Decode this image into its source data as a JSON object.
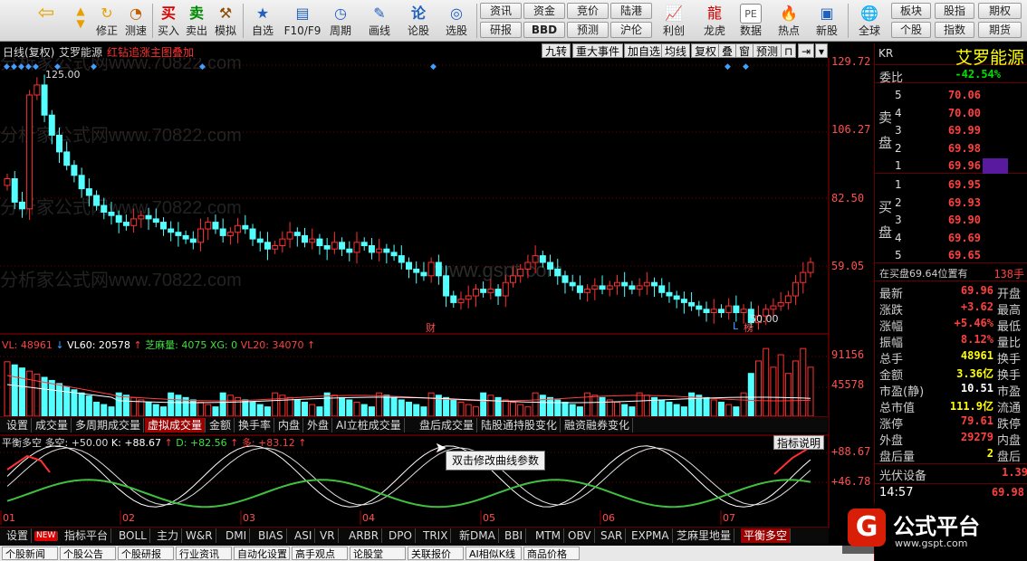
{
  "toolbar": {
    "buttons": [
      {
        "label": "",
        "icon": "back-arrow-icon"
      },
      {
        "label": "修正",
        "icon": "refresh-icon"
      },
      {
        "label": "测速",
        "icon": "clock-icon"
      },
      {
        "label": "买入",
        "icon": "buy-icon",
        "glyph": "买"
      },
      {
        "label": "卖出",
        "icon": "sell-icon",
        "glyph": "卖"
      },
      {
        "label": "模拟",
        "icon": "hammer-icon"
      },
      {
        "label": "自选",
        "icon": "star-icon"
      },
      {
        "label": "F10/F9",
        "icon": "f10-icon"
      },
      {
        "label": "周期",
        "icon": "cycle-icon"
      },
      {
        "label": "画线",
        "icon": "pencil-icon"
      },
      {
        "label": "论股",
        "icon": "discuss-icon",
        "glyph": "论"
      },
      {
        "label": "选股",
        "icon": "select-stock-icon"
      },
      {
        "label": "利创",
        "icon": "chart-icon"
      },
      {
        "label": "龙虎",
        "icon": "dragon-icon"
      },
      {
        "label": "数据",
        "icon": "pe-icon",
        "glyph": "PE"
      },
      {
        "label": "热点",
        "icon": "hot-icon"
      },
      {
        "label": "新股",
        "icon": "ipo-icon"
      },
      {
        "label": "全球",
        "icon": "globe-icon"
      }
    ],
    "pills_top": [
      "资讯",
      "资金",
      "竞价",
      "陆港"
    ],
    "pills_bottom": [
      "研报",
      "BBD",
      "预测",
      "沪伦"
    ],
    "right_pills_top": [
      "板块",
      "股指",
      "期权"
    ],
    "right_pills_bottom": [
      "个股",
      "指数",
      "期货"
    ]
  },
  "chart": {
    "title_prefix": "日线(复权)",
    "stock_name": "艾罗能源",
    "overlay": "红钻追涨主图叠加",
    "menu": [
      "九转",
      "重大事件",
      "加自选",
      "均线",
      "复权",
      "叠",
      "窗",
      "预测"
    ],
    "price_axis": [
      "129.72",
      "106.27",
      "82.50",
      "59.05"
    ],
    "high_label": "125.00",
    "low_label": "50.00",
    "markers": [
      "财",
      "L",
      "榜"
    ],
    "watermark_1": "分析家公式网www.70822.com",
    "watermark_2": "www.gspt.com"
  },
  "chart_data": {
    "type": "candlestick",
    "title": "艾罗能源 日线(复权)",
    "ylim": [
      50,
      130
    ],
    "high": 125.0,
    "low": 50.0,
    "x_ticks": [
      "01",
      "02",
      "03",
      "04",
      "05",
      "06",
      "07"
    ],
    "close_path": [
      95,
      88,
      86,
      120,
      123,
      114,
      108,
      103,
      99,
      96,
      92,
      90,
      87,
      85,
      84,
      82,
      81,
      83,
      84,
      83,
      82,
      80,
      79,
      78,
      77,
      76,
      80,
      82,
      80,
      78,
      79,
      81,
      80,
      77,
      76,
      74,
      75,
      77,
      79,
      78,
      76,
      77,
      75,
      74,
      76,
      74,
      73,
      76,
      75,
      73,
      74,
      73,
      72,
      70,
      68,
      67,
      66,
      70,
      66,
      60,
      58,
      59,
      60,
      62,
      61,
      62,
      60,
      64,
      66,
      68,
      70,
      72,
      70,
      68,
      66,
      64,
      63,
      61,
      62,
      63,
      62,
      63,
      64,
      63,
      62,
      63,
      64,
      63,
      61,
      60,
      59,
      58,
      57,
      56,
      55,
      56,
      55,
      57,
      55,
      56,
      52,
      54,
      56,
      57,
      58,
      60,
      64,
      67,
      70
    ]
  },
  "volume": {
    "label_vl": "VL: 48961",
    "label_vl60": "VL60: 20578",
    "label_zmf": "芝麻量: 4075",
    "label_xg": "XG: 0",
    "label_vl20": "VL20: 34070",
    "axis": [
      "91156",
      "45578"
    ]
  },
  "indicator_tabs": [
    "设置",
    "成交量",
    "多周期成交量",
    "虚拟成交量",
    "金额",
    "换手率",
    "内盘",
    "外盘",
    "AI立桩成交量",
    "盘后成交量",
    "陆股通持股变化",
    "融资融券变化"
  ],
  "indicator_active": "虚拟成交量",
  "oscillator": {
    "name": "平衡多空",
    "v1": "多空: +50.00",
    "v2": "K: +88.67",
    "v3": "D: +82.56",
    "v4": "多: +83.12",
    "axis": [
      "+88.67",
      "+46.78"
    ],
    "explain_button": "指标说明"
  },
  "tooltip": "双击修改曲线参数",
  "bottom_indicator_tabs": [
    "设置",
    "NEW",
    "指标平台",
    "BOLL",
    "主力",
    "W&R",
    "DMI",
    "BIAS",
    "ASI",
    "VR",
    "ARBR",
    "DPO",
    "TRIX",
    "新DMA",
    "BBI",
    "MTM",
    "OBV",
    "SAR",
    "EXPMA",
    "芝麻里地量",
    "平衡多空"
  ],
  "bottom_active": "平衡多空",
  "bottom_tabs": [
    "个股新闻",
    "个股公告",
    "个股研报",
    "行业资讯",
    "自动化设置",
    "高手观点",
    "论股堂",
    "关联报价",
    "AI相似K线",
    "商品价格"
  ],
  "right_panel": {
    "code": "KR",
    "name": "艾罗能源",
    "weibi_label": "委比",
    "weibi_value": "-42.54%",
    "sell_label": "卖盘",
    "buy_label": "买盘",
    "sell_orders": [
      {
        "n": "5",
        "p": "70.06"
      },
      {
        "n": "4",
        "p": "70.00"
      },
      {
        "n": "3",
        "p": "69.99"
      },
      {
        "n": "2",
        "p": "69.98"
      },
      {
        "n": "1",
        "p": "69.96"
      }
    ],
    "buy_orders": [
      {
        "n": "1",
        "p": "69.95"
      },
      {
        "n": "2",
        "p": "69.93"
      },
      {
        "n": "3",
        "p": "69.90"
      },
      {
        "n": "4",
        "p": "69.69"
      },
      {
        "n": "5",
        "p": "69.65"
      }
    ],
    "queue_label": "在买盘69.64位置有",
    "queue_value": "138手",
    "stats": [
      {
        "l": "最新",
        "v": "69.96",
        "c": "开盘",
        "cls": "red"
      },
      {
        "l": "涨跌",
        "v": "+3.62",
        "c": "最高",
        "cls": "red"
      },
      {
        "l": "涨幅",
        "v": "+5.46%",
        "c": "最低",
        "cls": "red"
      },
      {
        "l": "振幅",
        "v": "8.12%",
        "c": "量比",
        "cls": "red"
      },
      {
        "l": "总手",
        "v": "48961",
        "c": "换手",
        "cls": "yel"
      },
      {
        "l": "金额",
        "v": "3.36亿",
        "c": "换手",
        "cls": "yel"
      },
      {
        "l": "市盈(静)",
        "v": "10.51",
        "c": "市盈",
        "cls": "wht"
      },
      {
        "l": "总市值",
        "v": "111.9亿",
        "c": "流通",
        "cls": "yel"
      },
      {
        "l": "涨停",
        "v": "79.61",
        "c": "跌停",
        "cls": "red"
      },
      {
        "l": "外盘",
        "v": "29279",
        "c": "内盘",
        "cls": "red"
      },
      {
        "l": "盘后量",
        "v": "2",
        "c": "盘后",
        "cls": "yel"
      }
    ],
    "sector": "光伏设备",
    "sector_value": "1.39",
    "time": "14:57",
    "time_price": "69.98"
  },
  "logo": {
    "text": "公式平台",
    "url_text": "www.gspt.com"
  }
}
